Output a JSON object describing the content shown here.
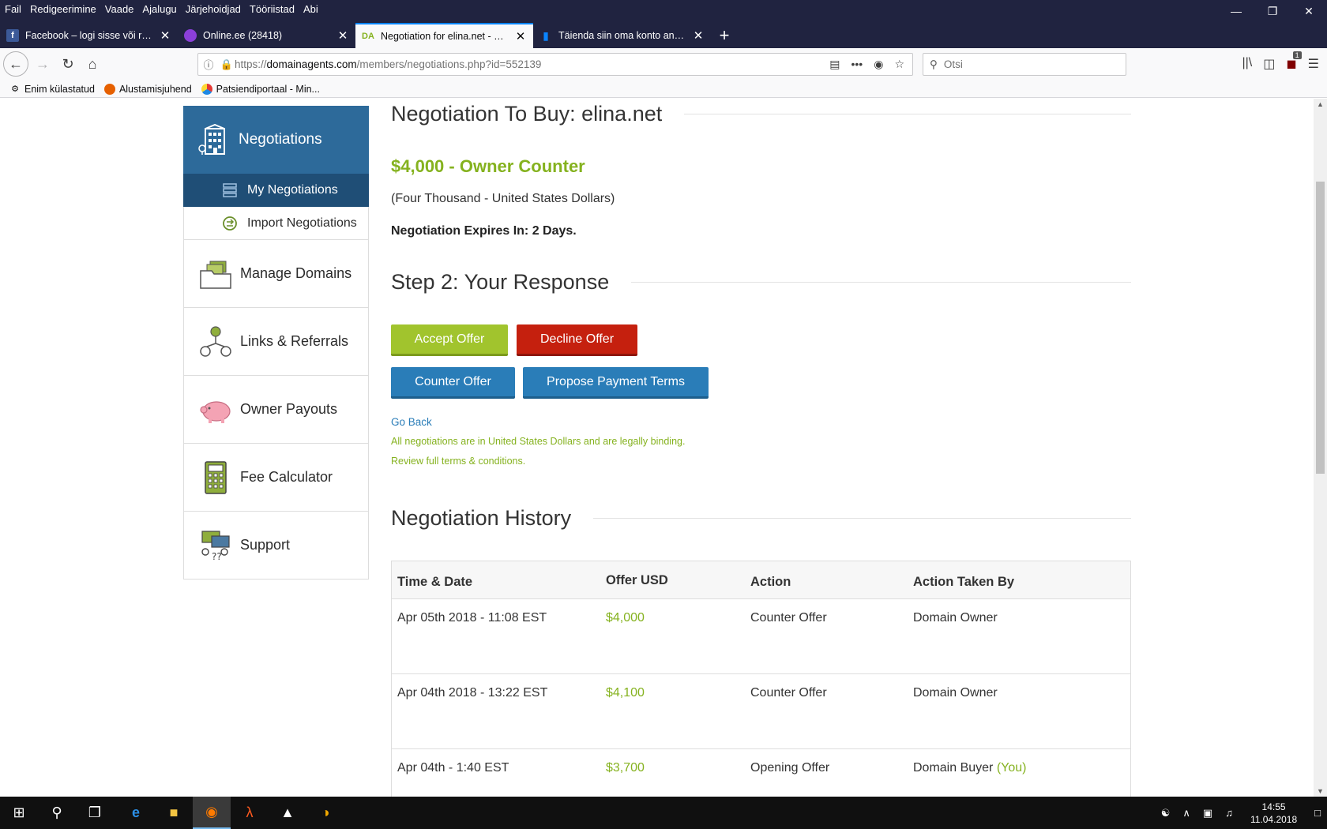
{
  "browser": {
    "menu": [
      "Fail",
      "Redigeerimine",
      "Vaade",
      "Ajalugu",
      "Järjehoidjad",
      "Tööriistad",
      "Abi"
    ],
    "tabs": [
      {
        "label": "Facebook – logi sisse või registreeru",
        "icon": "facebook-icon",
        "color": "#3b5998"
      },
      {
        "label": "Online.ee (28418)",
        "icon": "cloud-icon",
        "color": "#8b3fd9"
      },
      {
        "label": "Negotiation for elina.net - DomainAgents",
        "icon": "domainagents-icon",
        "color": "#85b21f"
      },
      {
        "label": "Täienda siin oma konto andmeid",
        "icon": "account-icon",
        "color": "#0a84ff"
      }
    ],
    "url": {
      "prefix": "https://",
      "host": "domainagents.com",
      "path": "/members/negotiations.php?id=552139"
    },
    "search_placeholder": "Otsi",
    "notif_count": "1",
    "bookmarks": [
      "Enim külastatud",
      "Alustamisjuhend",
      "Patsiendiportaal - Min..."
    ]
  },
  "sidebar": {
    "header": "Negotiations",
    "sub_items": [
      "My Negotiations",
      "Import Negotiations"
    ],
    "items": [
      "Manage Domains",
      "Links & Referrals",
      "Owner Payouts",
      "Fee Calculator",
      "Support"
    ]
  },
  "negotiation": {
    "title": "Negotiation To Buy: elina.net",
    "price_line": "$4,000 - Owner Counter",
    "amount_words": "(Four Thousand - United States Dollars)",
    "expires": "Negotiation Expires In: 2 Days."
  },
  "response": {
    "title": "Step 2: Your Response",
    "accept": "Accept Offer",
    "decline": "Decline Offer",
    "counter": "Counter Offer",
    "terms": "Propose Payment Terms",
    "go_back": "Go Back",
    "note1": "All negotiations are in United States Dollars and are legally binding.",
    "note2": "Review full terms & conditions."
  },
  "history": {
    "title": "Negotiation History",
    "columns": [
      "Time & Date",
      "Offer USD",
      "Action",
      "Action Taken By"
    ],
    "rows": [
      {
        "date": "Apr 05th 2018 - 11:08 EST",
        "offer": "$4,000",
        "action": "Counter Offer",
        "by": "Domain Owner",
        "you": ""
      },
      {
        "date": "Apr 04th 2018 - 13:22 EST",
        "offer": "$4,100",
        "action": "Counter Offer",
        "by": "Domain Owner",
        "you": ""
      },
      {
        "date": "Apr 04th - 1:40 EST",
        "offer": "$3,700",
        "action": "Opening Offer",
        "by": "Domain Buyer",
        "you": "(You)"
      }
    ]
  },
  "taskbar": {
    "time": "14:55",
    "date": "11.04.2018"
  },
  "colors": {
    "accent_green": "#85b21f",
    "brand_blue": "#2d6a9a",
    "decline_red": "#c5200e"
  }
}
